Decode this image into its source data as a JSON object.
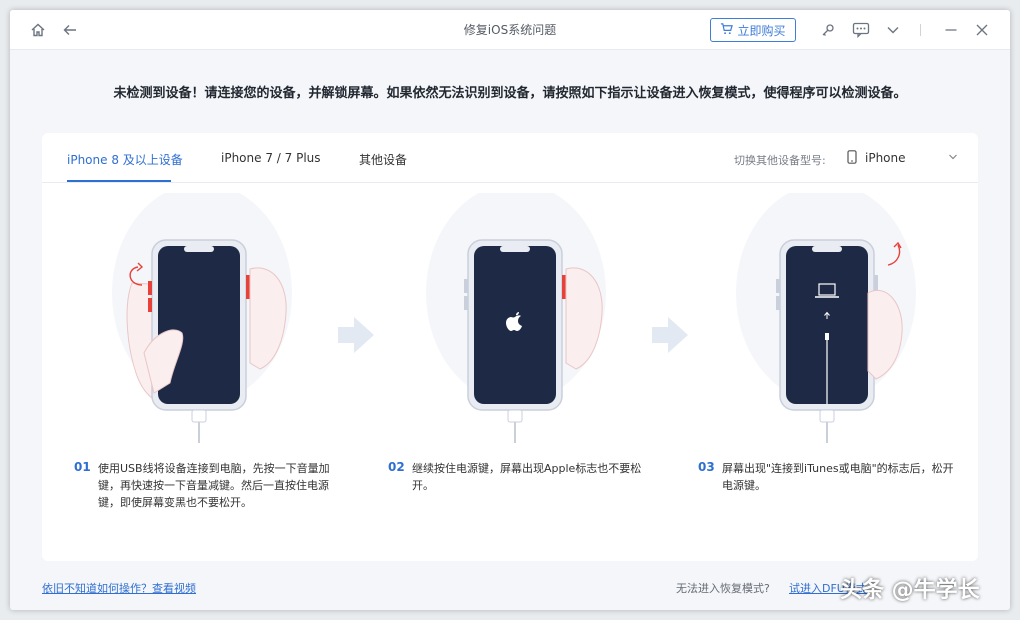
{
  "window": {
    "title": "修复iOS系统问题",
    "buy_label": "立即购买"
  },
  "notice": "未检测到设备！请连接您的设备，并解锁屏幕。如果依然无法识别到设备，请按照如下指示让设备进入恢复模式，使得程序可以检测设备。",
  "tabs": [
    {
      "label": "iPhone 8 及以上设备",
      "active": true
    },
    {
      "label": "iPhone 7 / 7 Plus",
      "active": false
    },
    {
      "label": "其他设备",
      "active": false
    }
  ],
  "model_switch": {
    "label": "切换其他设备型号:",
    "value": "iPhone"
  },
  "steps": [
    {
      "num": "01",
      "text": "使用USB线将设备连接到电脑，先按一下音量加键，再快速按一下音量减键。然后一直按住电源键，即使屏幕变黑也不要松开。"
    },
    {
      "num": "02",
      "text": "继续按住电源键，屏幕出现Apple标志也不要松开。"
    },
    {
      "num": "03",
      "text": "屏幕出现\"连接到iTunes或电脑\"的标志后，松开电源键。"
    }
  ],
  "footer": {
    "help_link": "依旧不知道如何操作？查看视频",
    "question": "无法进入恢复模式?",
    "dfu_link": "试进入DFU模式"
  },
  "watermark": "头条 @牛学长",
  "colors": {
    "accent": "#2f6fd1",
    "phone_screen": "#1e2a45",
    "button_highlight": "#e8413a"
  }
}
